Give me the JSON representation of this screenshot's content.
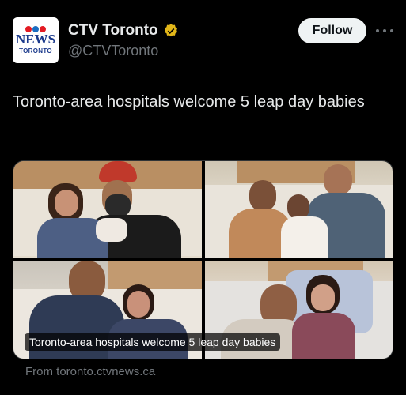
{
  "account": {
    "avatar": {
      "top": "CTV",
      "middle": "NEWS",
      "bottom": "TORONTO"
    },
    "display_name": "CTV Toronto",
    "handle": "@CTVToronto",
    "verified_badge_color": "#e2b719",
    "verified_icon": "verified-gold-badge-icon"
  },
  "actions": {
    "follow_label": "Follow",
    "more_icon": "more-options-icon"
  },
  "tweet": {
    "text": "Toronto-area hospitals welcome 5 leap day babies"
  },
  "link_card": {
    "caption": "Toronto-area hospitals welcome 5 leap day babies",
    "source": "From toronto.ctvnews.ca",
    "photos": [
      "family-photo-1",
      "family-photo-2",
      "family-photo-3",
      "family-photo-4"
    ]
  },
  "colors": {
    "background": "#000000",
    "text": "#e7e9ea",
    "secondary": "#71767b",
    "follow_bg": "#eff3f4"
  }
}
